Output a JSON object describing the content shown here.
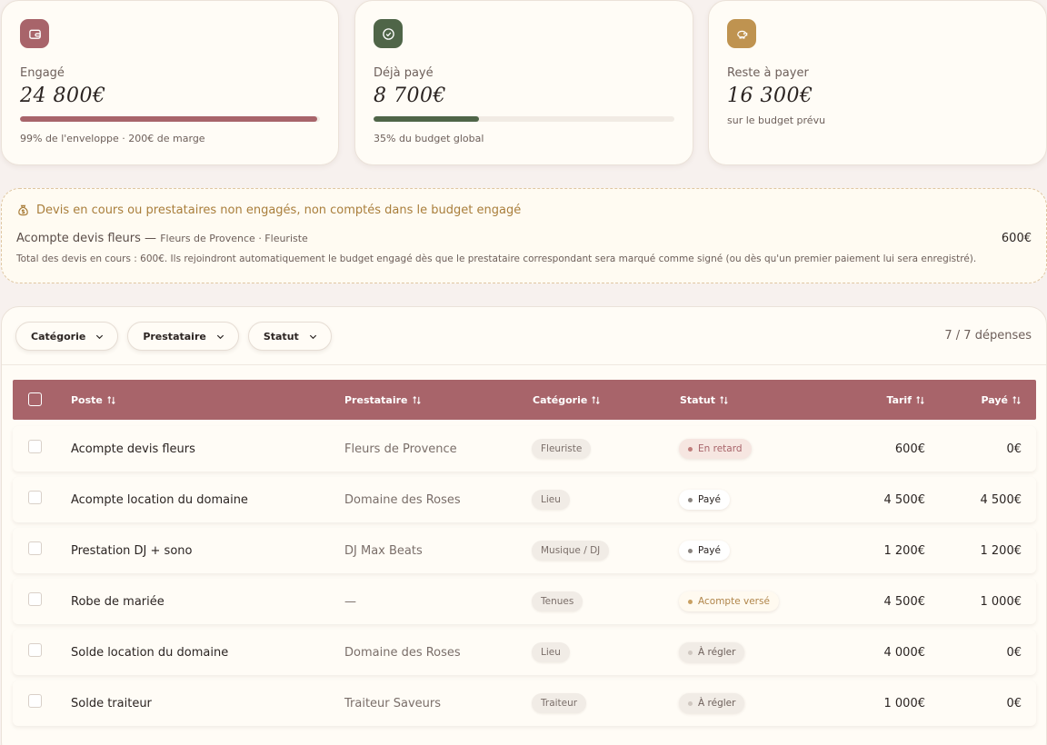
{
  "cards": [
    {
      "label": "Engagé",
      "value": "24 800€",
      "progress": 0.99,
      "bar_color": "#a8646a",
      "note": "99% de l'enveloppe · 200€ de marge",
      "icon": "wallet-icon",
      "icon_bg": "#a8646a"
    },
    {
      "label": "Déjà payé",
      "value": "8 700€",
      "progress": 0.35,
      "bar_color": "#4f6548",
      "note": "35% du budget global",
      "icon": "check-circle-icon",
      "icon_bg": "#4f6548"
    },
    {
      "label": "Reste à payer",
      "value": "16 300€",
      "note": "sur le budget prévu",
      "icon": "piggy-bank-icon",
      "icon_bg": "#bf9350"
    }
  ],
  "pending": {
    "title": "Devis en cours ou prestataires non engagés, non comptés dans le budget engagé",
    "item_name": "Acompte devis fleurs",
    "item_sep": " — ",
    "item_sub": "Fleurs de Provence · Fleuriste",
    "item_amount": "600€",
    "total_text": "Total des devis en cours : 600€. Ils rejoindront automatiquement le budget engagé dès que le prestataire correspondant sera marqué comme signé (ou dès qu'un premier paiement lui sera enregistré)."
  },
  "filters": [
    "Catégorie",
    "Prestataire",
    "Statut"
  ],
  "count": "7 / 7 dépenses",
  "table": {
    "headers": {
      "poste": "Poste",
      "prestataire": "Prestataire",
      "categorie": "Catégorie",
      "statut": "Statut",
      "tarif": "Tarif",
      "paye": "Payé"
    },
    "header_color": "#a8646a",
    "rows": [
      {
        "poste": "Acompte devis fleurs",
        "prestataire": "Fleurs de Provence",
        "categorie": "Fleuriste",
        "statut": "En retard",
        "status_kind": "late",
        "tarif": "600€",
        "paye": "0€"
      },
      {
        "poste": "Acompte location du domaine",
        "prestataire": "Domaine des Roses",
        "categorie": "Lieu",
        "statut": "Payé",
        "status_kind": "paid",
        "tarif": "4 500€",
        "paye": "4 500€"
      },
      {
        "poste": "Prestation DJ + sono",
        "prestataire": "DJ Max Beats",
        "categorie": "Musique / DJ",
        "statut": "Payé",
        "status_kind": "paid",
        "tarif": "1 200€",
        "paye": "1 200€"
      },
      {
        "poste": "Robe de mariée",
        "prestataire": "—",
        "categorie": "Tenues",
        "statut": "Acompte versé",
        "status_kind": "deposit",
        "tarif": "4 500€",
        "paye": "1 000€"
      },
      {
        "poste": "Solde location du domaine",
        "prestataire": "Domaine des Roses",
        "categorie": "Lieu",
        "statut": "À régler",
        "status_kind": "due",
        "tarif": "4 000€",
        "paye": "0€"
      },
      {
        "poste": "Solde traiteur",
        "prestataire": "Traiteur Saveurs",
        "categorie": "Traiteur",
        "statut": "À régler",
        "status_kind": "due",
        "tarif": "1 000€",
        "paye": "0€"
      }
    ]
  },
  "status_styles": {
    "late": {
      "bg": "#f6e6e1",
      "color": "#a8646a",
      "dot": "#c07d7b"
    },
    "paid": {
      "bg": "#ffffff",
      "color": "#2b2422",
      "dot": "#8a8480"
    },
    "deposit": {
      "bg": "#fffaf0",
      "color": "#b0854a",
      "dot": "#c9a062"
    },
    "due": {
      "bg": "#f1ece6",
      "color": "#6d5f5a",
      "dot": "#cfc7c0"
    }
  }
}
